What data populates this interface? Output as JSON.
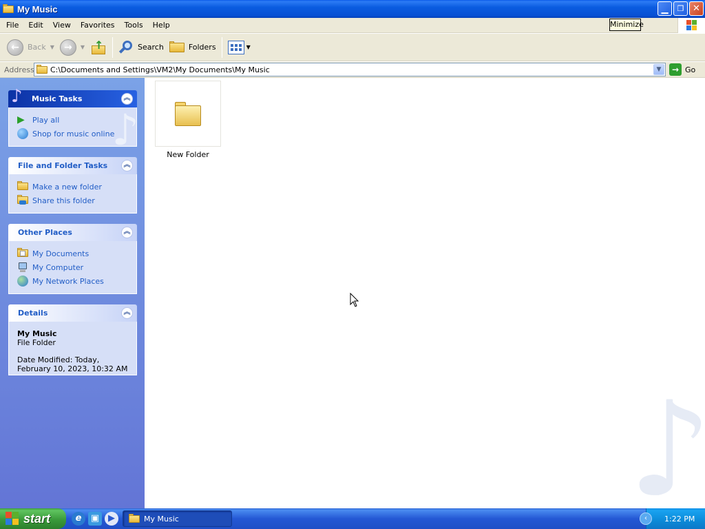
{
  "window": {
    "title": "My Music"
  },
  "menu": {
    "items": [
      "File",
      "Edit",
      "View",
      "Favorites",
      "Tools",
      "Help"
    ]
  },
  "tooltip": "Minimize",
  "toolbar": {
    "back_label": "Back",
    "search_label": "Search",
    "folders_label": "Folders"
  },
  "address": {
    "label": "Address",
    "path": "C:\\Documents and Settings\\VM2\\My Documents\\My Music",
    "go_label": "Go"
  },
  "panels": {
    "music_tasks": {
      "title": "Music Tasks",
      "items": [
        "Play all",
        "Shop for music online"
      ]
    },
    "file_folder_tasks": {
      "title": "File and Folder Tasks",
      "items": [
        "Make a new folder",
        "Share this folder"
      ]
    },
    "other_places": {
      "title": "Other Places",
      "items": [
        "My Documents",
        "My Computer",
        "My Network Places"
      ]
    },
    "details": {
      "title": "Details",
      "name": "My Music",
      "type": "File Folder",
      "date_modified": "Date Modified: Today, February 10, 2023, 10:32 AM"
    }
  },
  "content": {
    "items": [
      {
        "name": "New Folder",
        "icon": "folder-icon"
      }
    ]
  },
  "taskbar": {
    "start_label": "start",
    "task_button": "My Music",
    "clock": "1:22 PM"
  },
  "colors": {
    "titlebar": "#0750d4",
    "task_link": "#215dc6",
    "left_pane": "#7ba2e7",
    "start_green": "#3a9a3a"
  }
}
